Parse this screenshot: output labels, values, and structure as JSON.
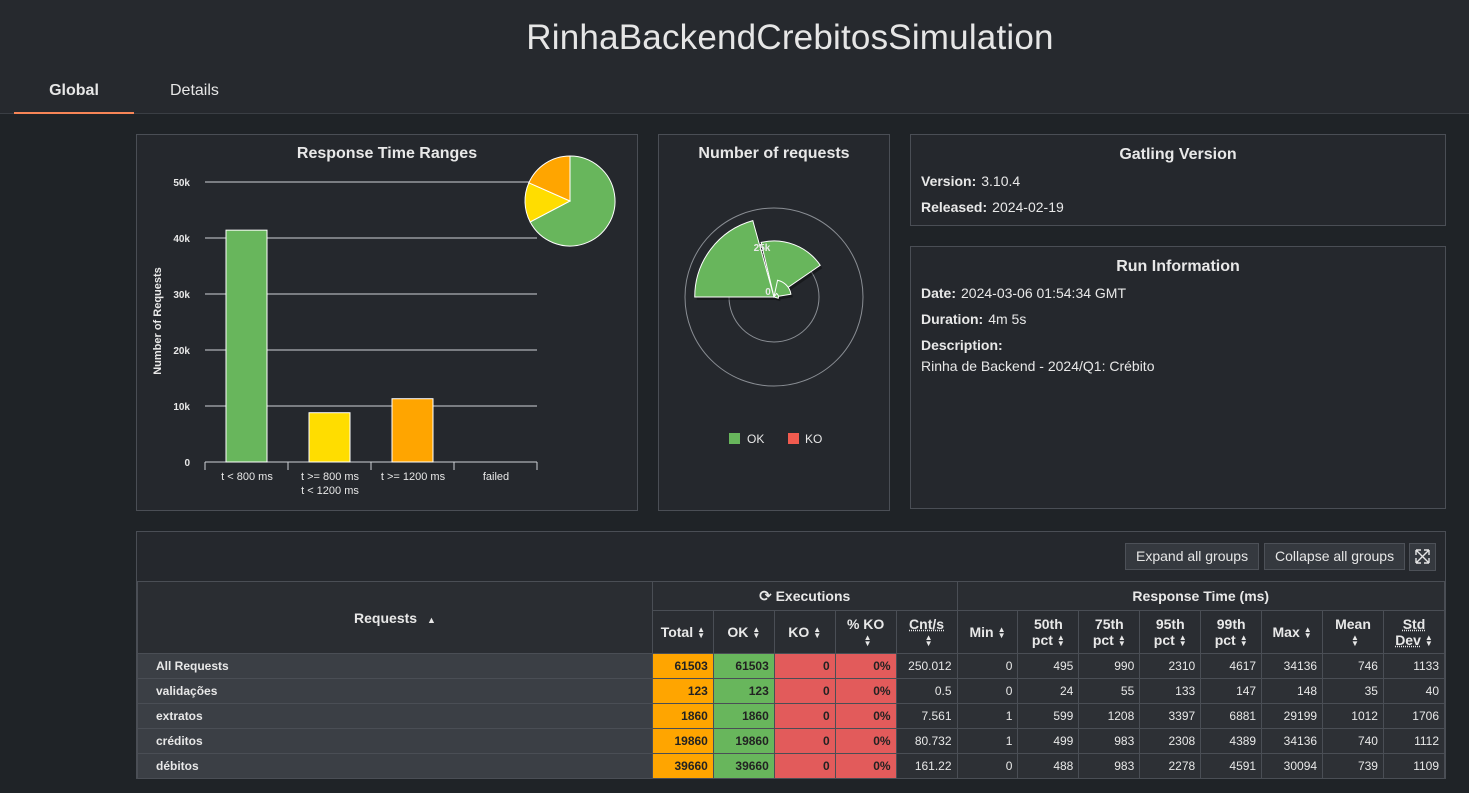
{
  "app": {
    "title": "RinhaBackendCrebitosSimulation"
  },
  "tabs": [
    {
      "label": "Global"
    },
    {
      "label": "Details"
    }
  ],
  "response_time_ranges": {
    "title": "Response Time Ranges",
    "ylabel": "Number of Requests",
    "yticks": [
      "0",
      "10k",
      "20k",
      "30k",
      "40k",
      "50k"
    ],
    "categories": [
      {
        "line1": "t < 800 ms",
        "line2": ""
      },
      {
        "line1": "t >= 800 ms",
        "line2": "t < 1200 ms"
      },
      {
        "line1": "t >= 1200 ms",
        "line2": ""
      },
      {
        "line1": "failed",
        "line2": ""
      }
    ]
  },
  "number_of_requests": {
    "title": "Number of requests",
    "ticks": [
      "25k",
      "0"
    ],
    "legend": [
      {
        "label": "OK",
        "color": "#68b65c"
      },
      {
        "label": "KO",
        "color": "#f15b4f"
      }
    ]
  },
  "chart_data": [
    {
      "type": "bar",
      "title": "Response Time Ranges",
      "ylabel": "Number of Requests",
      "categories": [
        "t < 800 ms",
        "t >= 800 ms / t < 1200 ms",
        "t >= 1200 ms",
        "failed"
      ],
      "values": [
        41400,
        8800,
        11300,
        0
      ],
      "colors": [
        "#68b65c",
        "#ffdd00",
        "#ffa500",
        "#f15b4f"
      ],
      "ylim": [
        0,
        50000
      ],
      "inset_pie": {
        "values": [
          41400,
          8800,
          11300
        ],
        "colors": [
          "#68b65c",
          "#ffdd00",
          "#ffa500"
        ]
      }
    },
    {
      "type": "pie",
      "title": "Number of requests",
      "polar": true,
      "series": [
        {
          "name": "OK",
          "values": [
            39660,
            19860,
            1860,
            123
          ],
          "color": "#68b65c"
        },
        {
          "name": "KO",
          "values": [
            0,
            0,
            0,
            0
          ],
          "color": "#f15b4f"
        }
      ],
      "rlim": [
        0,
        50000
      ]
    }
  ],
  "gatling": {
    "title": "Gatling Version",
    "version_label": "Version:",
    "version": "3.10.4",
    "released_label": "Released:",
    "released": "2024-02-19"
  },
  "run": {
    "title": "Run Information",
    "date_label": "Date:",
    "date": "2024-03-06 01:54:34 GMT",
    "duration_label": "Duration:",
    "duration": "4m 5s",
    "description_label": "Description:",
    "description": "Rinha de Backend - 2024/Q1: Crébito"
  },
  "stats": {
    "expand_label": "Expand all groups",
    "collapse_label": "Collapse all groups",
    "requests_header": "Requests",
    "executions_header": "Executions",
    "response_time_header": "Response Time (ms)",
    "columns": {
      "total": "Total",
      "ok": "OK",
      "ko": "KO",
      "pct_ko": "% KO",
      "cnt_s": "Cnt/s",
      "min": "Min",
      "p50a": "50th",
      "p50b": "pct",
      "p75a": "75th",
      "p75b": "pct",
      "p95a": "95th",
      "p95b": "pct",
      "p99a": "99th",
      "p99b": "pct",
      "max": "Max",
      "mean": "Mean",
      "stda": "Std",
      "stdb": "Dev"
    },
    "rows": [
      {
        "name": "All Requests",
        "total": "61503",
        "ok": "61503",
        "ko": "0",
        "pct_ko": "0%",
        "cnt_s": "250.012",
        "min": "0",
        "p50": "495",
        "p75": "990",
        "p95": "2310",
        "p99": "4617",
        "max": "34136",
        "mean": "746",
        "std": "1133"
      },
      {
        "name": "validações",
        "total": "123",
        "ok": "123",
        "ko": "0",
        "pct_ko": "0%",
        "cnt_s": "0.5",
        "min": "0",
        "p50": "24",
        "p75": "55",
        "p95": "133",
        "p99": "147",
        "max": "148",
        "mean": "35",
        "std": "40"
      },
      {
        "name": "extratos",
        "total": "1860",
        "ok": "1860",
        "ko": "0",
        "pct_ko": "0%",
        "cnt_s": "7.561",
        "min": "1",
        "p50": "599",
        "p75": "1208",
        "p95": "3397",
        "p99": "6881",
        "max": "29199",
        "mean": "1012",
        "std": "1706"
      },
      {
        "name": "créditos",
        "total": "19860",
        "ok": "19860",
        "ko": "0",
        "pct_ko": "0%",
        "cnt_s": "80.732",
        "min": "1",
        "p50": "499",
        "p75": "983",
        "p95": "2308",
        "p99": "4389",
        "max": "34136",
        "mean": "740",
        "std": "1112"
      },
      {
        "name": "débitos",
        "total": "39660",
        "ok": "39660",
        "ko": "0",
        "pct_ko": "0%",
        "cnt_s": "161.22",
        "min": "0",
        "p50": "488",
        "p75": "983",
        "p95": "2278",
        "p99": "4591",
        "max": "30094",
        "mean": "739",
        "std": "1109"
      }
    ]
  }
}
